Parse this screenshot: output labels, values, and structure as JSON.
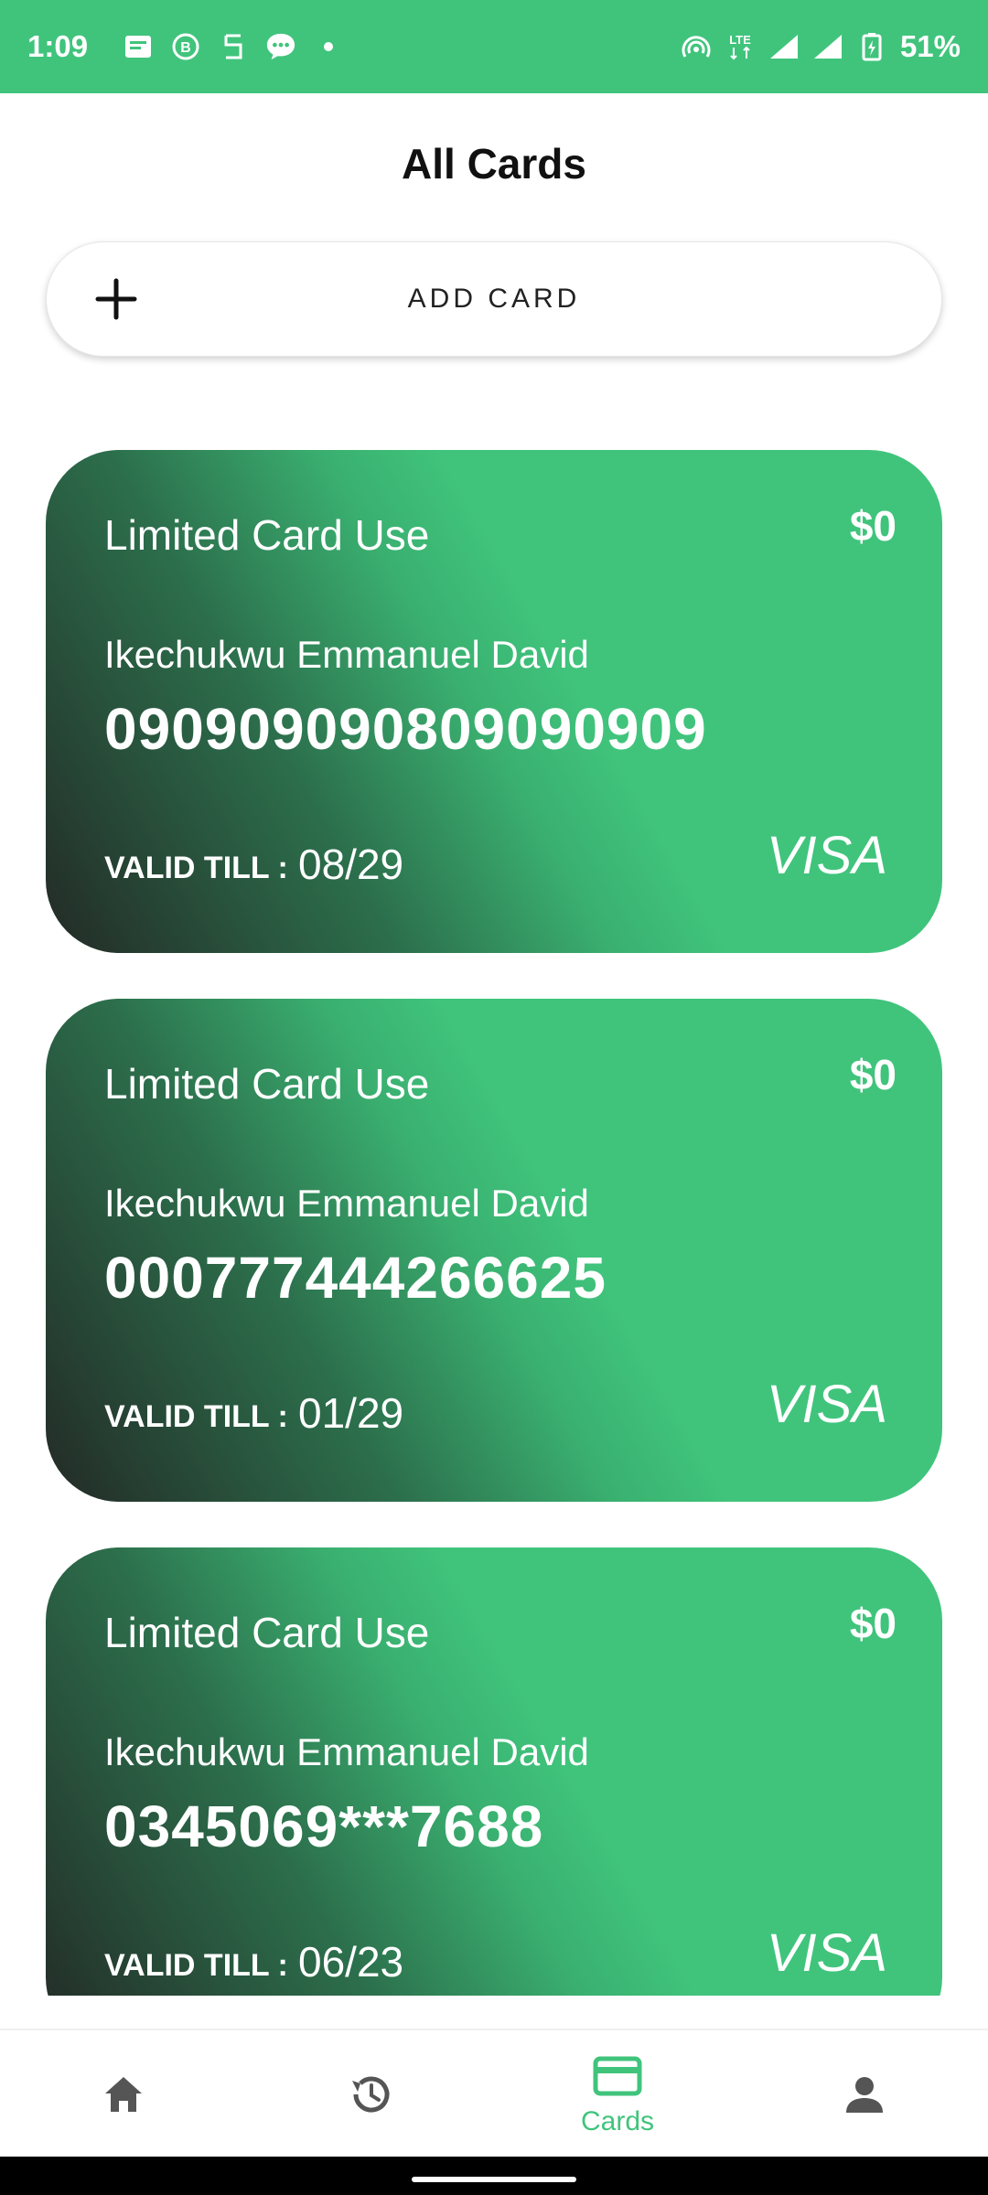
{
  "status": {
    "time": "1:09",
    "battery": "51%",
    "network": "LTE"
  },
  "page": {
    "title": "All Cards"
  },
  "add_card": {
    "label": "ADD CARD"
  },
  "cards": [
    {
      "title": "Limited Card Use",
      "amount": "$0",
      "holder": "Ikechukwu Emmanuel David",
      "number": "090909090809090909",
      "valid_label": "VALID TILL :",
      "valid": "08/29",
      "brand": "VISA"
    },
    {
      "title": "Limited Card Use",
      "amount": "$0",
      "holder": "Ikechukwu Emmanuel David",
      "number": "000777444266625",
      "valid_label": "VALID TILL :",
      "valid": "01/29",
      "brand": "VISA"
    },
    {
      "title": "Limited Card Use",
      "amount": "$0",
      "holder": "Ikechukwu Emmanuel David",
      "number": "0345069***7688",
      "valid_label": "VALID TILL :",
      "valid": "06/23",
      "brand": "VISA"
    }
  ],
  "nav": {
    "items": [
      {
        "icon": "home-icon",
        "label": ""
      },
      {
        "icon": "history-icon",
        "label": ""
      },
      {
        "icon": "card-icon",
        "label": "Cards"
      },
      {
        "icon": "person-icon",
        "label": ""
      }
    ],
    "active_color": "#40c47c",
    "inactive_color": "#555555"
  },
  "colors": {
    "brand": "#40c47c"
  }
}
